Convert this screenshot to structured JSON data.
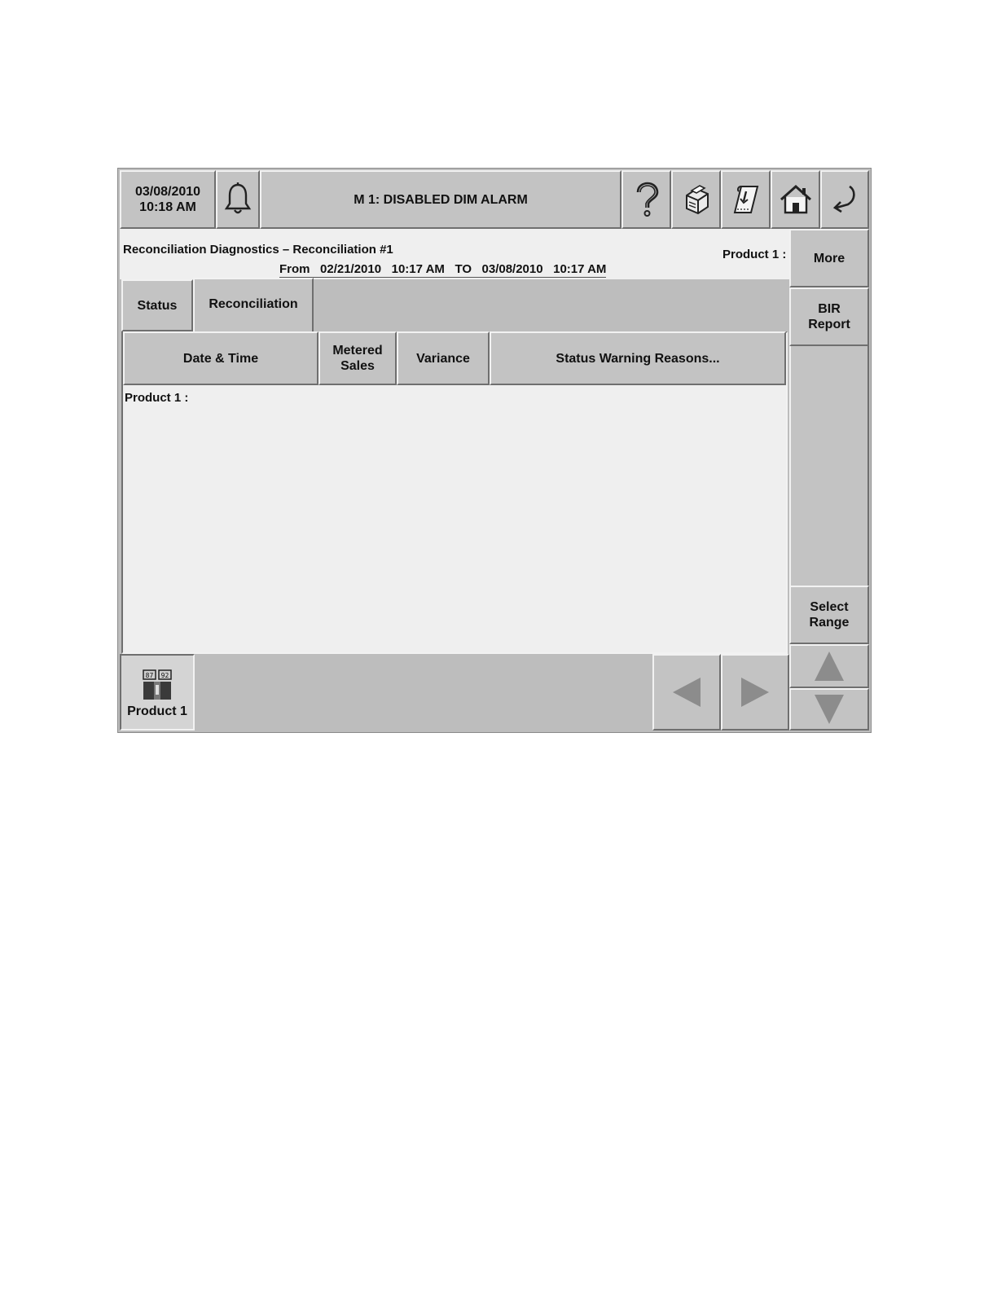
{
  "topbar": {
    "date": "03/08/2010",
    "time": "10:18 AM",
    "alarm_message": "M 1: DISABLED DIM ALARM",
    "icons": [
      "bell-icon",
      "help-icon",
      "printer-icon",
      "receipt-icon",
      "home-icon",
      "back-icon"
    ]
  },
  "info": {
    "title": "Reconciliation Diagnostics  –  Reconciliation #1",
    "from_label": "From",
    "from_date": "02/21/2010",
    "from_time": "10:17 AM",
    "to_label": "TO",
    "to_date": "03/08/2010",
    "to_time": "10:17 AM",
    "product_label": "Product 1 :"
  },
  "tabs": [
    {
      "label": "Status",
      "active": false
    },
    {
      "label": "Reconciliation",
      "active": true
    }
  ],
  "table": {
    "headers": {
      "date_time": "Date & Time",
      "metered_line1": "Metered",
      "metered_line2": "Sales",
      "variance": "Variance",
      "reasons": "Status Warning Reasons..."
    },
    "group_label": "Product 1 :",
    "rows": []
  },
  "side": {
    "more": "More",
    "bir_line1": "BIR",
    "bir_line2": "Report",
    "select_line1": "Select",
    "select_line2": "Range"
  },
  "bottom": {
    "product_button": "Product 1",
    "product_icon_labels": [
      "87",
      "92"
    ]
  },
  "colors": {
    "panel_gray": "#c3c3c3",
    "content_bg": "#efefef",
    "arrow_gray": "#8c8c8c"
  }
}
